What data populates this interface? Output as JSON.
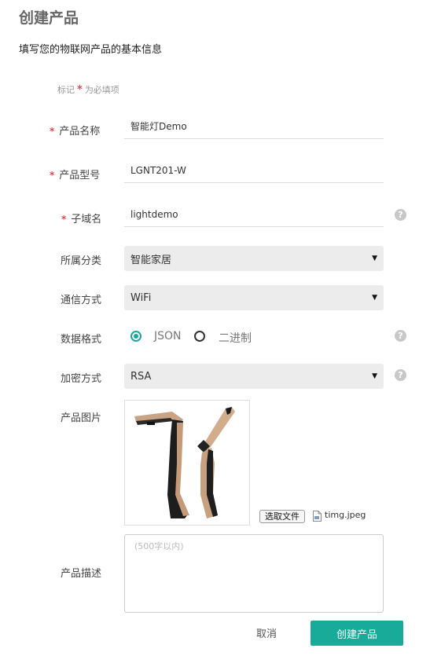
{
  "page": {
    "title": "创建产品",
    "subtitle": "填写您的物联网产品的基本信息"
  },
  "required_note": {
    "prefix": "标记",
    "star": "*",
    "suffix": "为必填项"
  },
  "form": {
    "product_name": {
      "label": "产品名称",
      "value": "智能灯Demo",
      "required": true
    },
    "product_model": {
      "label": "产品型号",
      "value": "LGNT201-W",
      "required": true
    },
    "subdomain": {
      "label": "子域名",
      "value": "lightdemo",
      "required": true,
      "help": "?"
    },
    "category": {
      "label": "所属分类",
      "selected": "智能家居",
      "caret": "▼"
    },
    "communication": {
      "label": "通信方式",
      "selected": "WiFi",
      "caret": "▼"
    },
    "data_format": {
      "label": "数据格式",
      "options": [
        "JSON",
        "二进制"
      ],
      "selected": "JSON",
      "help": "?"
    },
    "encryption": {
      "label": "加密方式",
      "selected": "RSA",
      "caret": "▼",
      "help": "?"
    },
    "product_image": {
      "label": "产品图片",
      "choose_file_label": "选取文件",
      "file_name": "timg.jpeg"
    },
    "description": {
      "label": "产品描述",
      "placeholder": "(500字以内)"
    }
  },
  "actions": {
    "cancel_label": "取消",
    "submit_label": "创建产品"
  },
  "colors": {
    "accent": "#18ab99",
    "required": "#e6464a",
    "field_bg": "#ececec"
  },
  "icons": {
    "help": "question-circle-icon",
    "caret": "caret-down-icon",
    "file": "image-file-icon"
  }
}
